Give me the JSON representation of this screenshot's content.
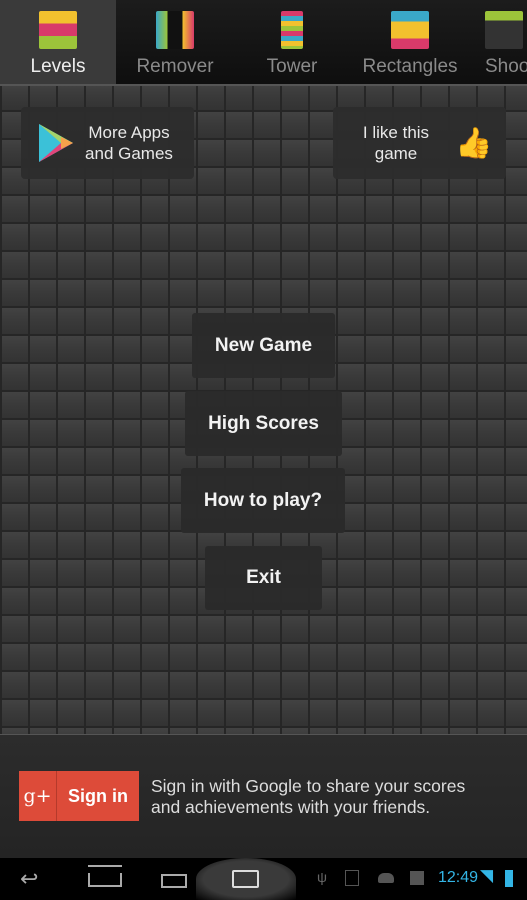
{
  "tabs": [
    {
      "label": "Levels",
      "icon": "levels-icon",
      "active": true
    },
    {
      "label": "Remover",
      "icon": "remover-icon"
    },
    {
      "label": "Tower",
      "icon": "tower-icon"
    },
    {
      "label": "Rectangles",
      "icon": "rectangles-icon"
    },
    {
      "label": "Shoo",
      "icon": "shooter-icon"
    }
  ],
  "promo": {
    "more_apps": "More Apps and Games",
    "like": "I like this game"
  },
  "menu": {
    "new_game": "New Game",
    "high_scores": "High Scores",
    "how_to_play": "How to play?",
    "exit": "Exit"
  },
  "signin": {
    "g_label": "g+",
    "button": "Sign in",
    "text": "Sign in with Google to share your scores and achievements with your friends.",
    "color": "#dd4b39"
  },
  "status": {
    "time": "12:49",
    "time_color": "#33b5e5"
  }
}
